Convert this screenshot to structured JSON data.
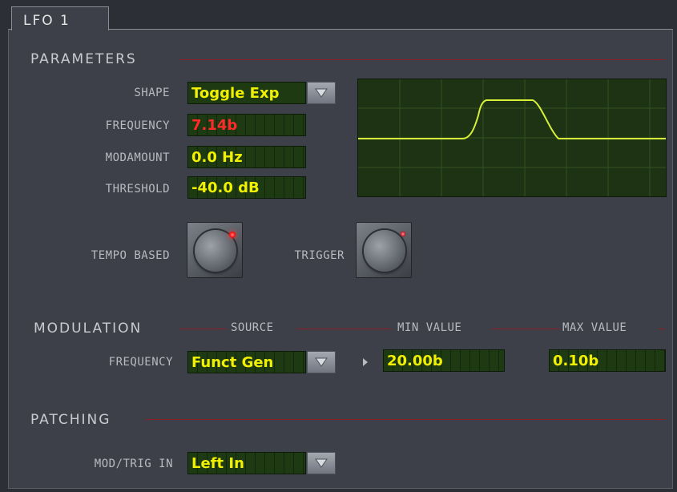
{
  "tabs": [
    {
      "label": "LFO 1"
    }
  ],
  "sections": {
    "parameters": "PARAMETERS",
    "modulation": "MODULATION",
    "patching": "PATCHING"
  },
  "parameters": {
    "shape": {
      "label": "SHAPE",
      "value": "Toggle Exp"
    },
    "frequency": {
      "label": "FREQUENCY",
      "value": "7.14b",
      "value_color": "#ff2a2a"
    },
    "modamount": {
      "label": "MODAMOUNT",
      "value": "0.0 Hz"
    },
    "threshold": {
      "label": "THRESHOLD",
      "value": "-40.0 dB"
    }
  },
  "buttons": {
    "tempo_based": {
      "label": "TEMPO BASED",
      "led": "on"
    },
    "trigger": {
      "label": "TRIGGER",
      "led": "dim"
    }
  },
  "modulation": {
    "columns": {
      "source": "SOURCE",
      "min_value": "MIN VALUE",
      "max_value": "MAX VALUE"
    },
    "row": {
      "label": "FREQUENCY",
      "source": "Funct Gen",
      "min_value": "20.00b",
      "max_value": "0.10b"
    }
  },
  "patching": {
    "mod_trig_in": {
      "label": "MOD/TRIG IN",
      "value": "Left In"
    }
  },
  "icons": {
    "dropdown": "triangle-down-icon",
    "expand": "triangle-right-icon"
  },
  "colors": {
    "accent_line": "#8a1e24",
    "value_text": "#f0f000",
    "display_bg": "#1d3a13",
    "waveform": "#d6f03a",
    "led": "#ff1a1a"
  }
}
